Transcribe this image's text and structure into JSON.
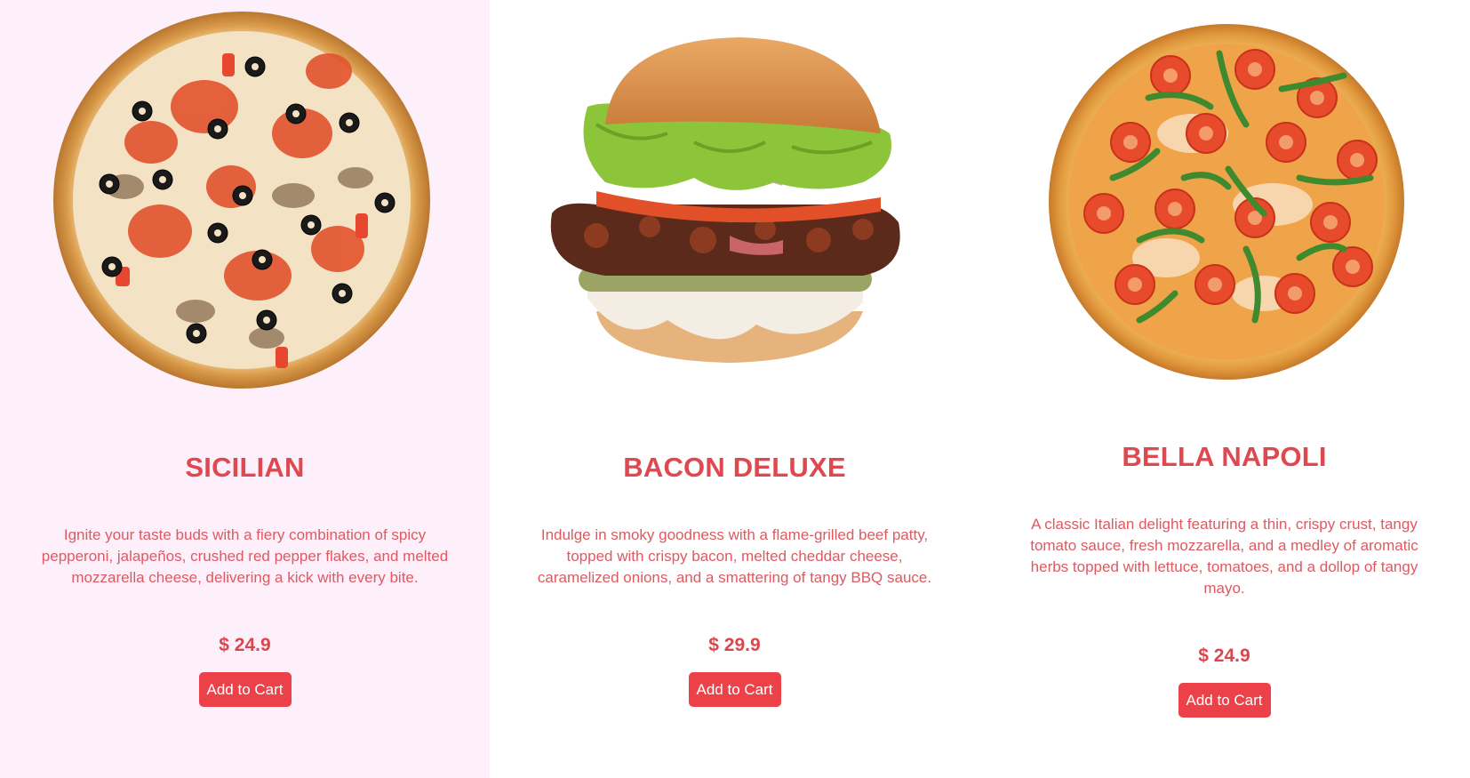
{
  "products": [
    {
      "name": "SICILIAN",
      "description": "Ignite your taste buds with a fiery combination of spicy pepperoni, jalapeños, crushed red pepper flakes, and melted mozzarella cheese, delivering a kick with every bite.",
      "price": "$ 24.9",
      "button_label": "Add to Cart",
      "image": "pizza-veggie-olives"
    },
    {
      "name": "BACON DELUXE",
      "description": "Indulge in smoky goodness with a flame-grilled beef patty, topped with crispy bacon, melted cheddar cheese, caramelized onions, and a smattering of tangy BBQ sauce.",
      "price": "$ 29.9",
      "button_label": "Add to Cart",
      "image": "burger-bacon-lettuce"
    },
    {
      "name": "BELLA NAPOLI",
      "description": "A classic Italian delight featuring a thin, crispy crust, tangy tomato sauce, fresh mozzarella, and a medley of aromatic herbs topped with lettuce, tomatoes, and a dollop of tangy mayo.",
      "price": "$ 24.9",
      "button_label": "Add to Cart",
      "image": "pizza-tomato-arugula"
    }
  ],
  "colors": {
    "accent": "#ed4149",
    "title": "#e04850",
    "highlight_bg": "#fdf0fb"
  }
}
